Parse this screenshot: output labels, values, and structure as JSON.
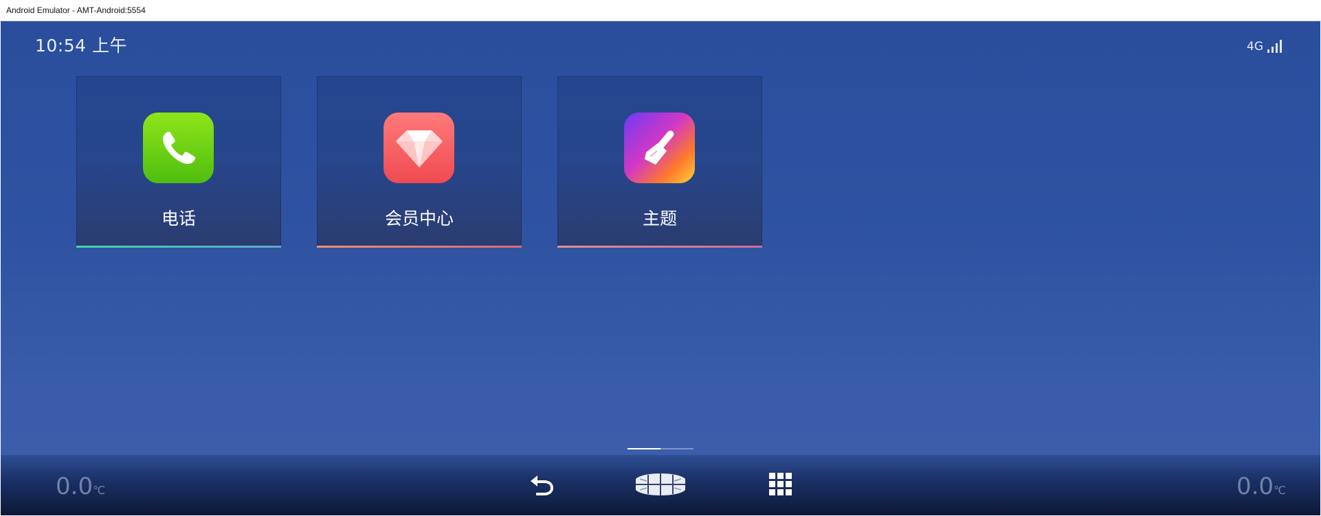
{
  "window": {
    "title": "Android Emulator - AMT-Android:5554"
  },
  "status_bar": {
    "time": "10:54 上午",
    "network": "4G",
    "signal_bars": 4
  },
  "apps": [
    {
      "label": "电话",
      "icon": "phone-icon",
      "bar_color": "#4fd3b0"
    },
    {
      "label": "会员中心",
      "icon": "diamond-icon",
      "bar_color": "#f08a6a"
    },
    {
      "label": "主题",
      "icon": "paintbrush-icon",
      "bar_color": "#e08a8a"
    }
  ],
  "pager": {
    "pages": 2,
    "current": 1
  },
  "bottom_bar": {
    "temp_left": {
      "value": "0.0",
      "unit": "℃"
    },
    "temp_right": {
      "value": "0.0",
      "unit": "℃"
    },
    "nav": {
      "back_icon": "back-arrow-icon",
      "home_icon": "car-logo-icon",
      "apps_icon": "app-grid-icon"
    }
  },
  "colors": {
    "screen_background": "#2f53a2",
    "tile_background": "#27468b",
    "text": "#ffffff",
    "temperature_text": "#7382a8"
  }
}
